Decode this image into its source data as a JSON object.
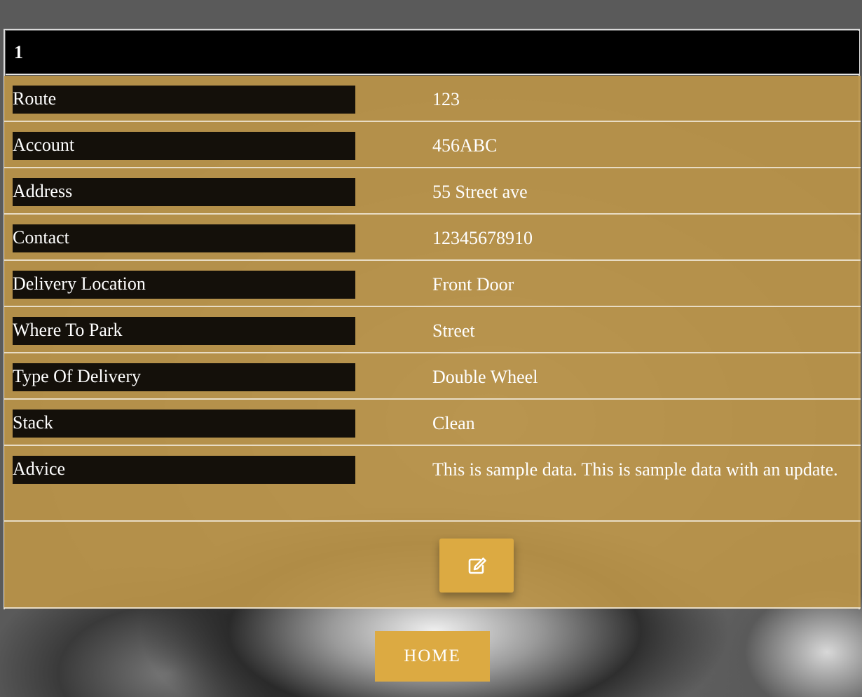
{
  "card": {
    "header": "1"
  },
  "fields": [
    {
      "label": "Route",
      "value": "123"
    },
    {
      "label": "Account",
      "value": "456ABC"
    },
    {
      "label": "Address",
      "value": "55 Street ave"
    },
    {
      "label": "Contact",
      "value": "12345678910"
    },
    {
      "label": "Delivery Location",
      "value": "Front Door"
    },
    {
      "label": "Where To Park",
      "value": "Street"
    },
    {
      "label": "Type Of Delivery",
      "value": "Double Wheel"
    },
    {
      "label": "Stack",
      "value": "Clean"
    },
    {
      "label": "Advice",
      "value": "This is sample data. This is sample data with an update."
    }
  ],
  "actions": {
    "edit_icon": "edit-icon",
    "home_label": "HOME"
  },
  "colors": {
    "accent": "#dcaa42",
    "row_background": "#ba9348",
    "label_background": "#14100a",
    "header_background": "#000000"
  }
}
